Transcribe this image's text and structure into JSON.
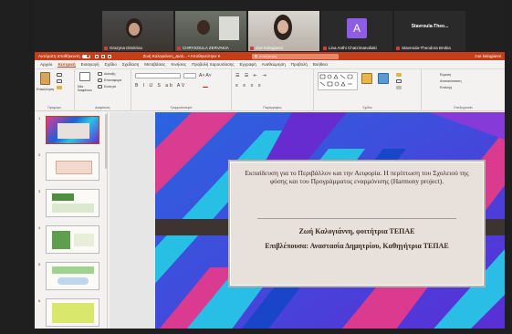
{
  "participants": [
    {
      "name": "Grazyna Dimitriou",
      "kind": "video"
    },
    {
      "name": "CHRYSOULA ZERVAKIA",
      "kind": "video"
    },
    {
      "name": "Zoe Kalogianni",
      "kind": "video"
    },
    {
      "name": "Lina Anthi Chatzimanoliaki",
      "kind": "avatar",
      "initial": "A"
    },
    {
      "name": "Stavroula-Theodora Brokia",
      "kind": "name",
      "display": "Stavroula-Theo..."
    }
  ],
  "titlebar": {
    "autosave": "Αυτόματη αποθήκευση",
    "doc_title": "Ζωή Καλογιάννη_Διαλ...  •  Αποθηκεύτηκε ▾",
    "search": "Αναζήτηση",
    "user": "zoe kalogianni"
  },
  "menu": [
    "Αρχείο",
    "Κεντρική",
    "Εισαγωγή",
    "Σχέδιο",
    "Σχεδίαση",
    "Μεταβάσεις",
    "Κινήσεις",
    "Προβολή παρουσίασης",
    "Εγγραφή",
    "Αναθεώρηση",
    "Προβολή",
    "Βοήθεια"
  ],
  "menu_active": "Κεντρική",
  "ribbon": {
    "groups": [
      "Πρόχειρο",
      "Διαφάνειες",
      "Γραμματοσειρά",
      "Παράγραφος",
      "Σχέδιο",
      "Επεξεργασία"
    ],
    "paste": "Επικόλληση",
    "new_slide": "Νέα διαφάνεια",
    "layout": "Διάταξη",
    "reset": "Επαναφορά",
    "section": "Ενότητα",
    "find": "Εύρεση",
    "replace": "Αντικατάσταση",
    "select": "Επιλογή"
  },
  "thumbnails": [
    {
      "num": "1",
      "selected": true
    },
    {
      "num": "2",
      "selected": false
    },
    {
      "num": "3",
      "selected": false
    },
    {
      "num": "4",
      "selected": false
    },
    {
      "num": "5",
      "selected": false
    },
    {
      "num": "6",
      "selected": false
    }
  ],
  "slide": {
    "heading": "Εκπαίδευση για το Περιβάλλον και την Αειφορία. Η περίπτωση του Σχολειού της φύσης και του Προγράμματος εναρμόνισης (Harmony project).",
    "author": "Ζωή Καλογιάννη, φοιτήτρια ΤΕΠΑΕ",
    "supervisor": "Επιβλέπουσα: Αναστασία Δημητρίου, Καθηγήτρια ΤΕΠΑΕ"
  },
  "colors": {
    "accent": "#c43e1c",
    "slide_blue": "#1e5fd6",
    "slide_cyan": "#28c5e6",
    "slide_magenta": "#e33b8c",
    "slide_purple": "#6a2ad0"
  }
}
